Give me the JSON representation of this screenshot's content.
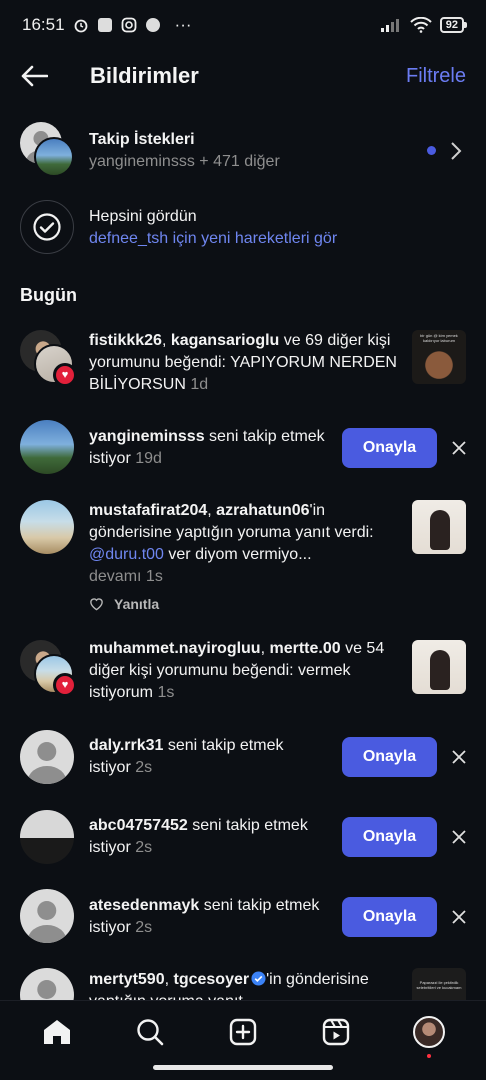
{
  "status_bar": {
    "time": "16:51",
    "more": "···",
    "battery": "92"
  },
  "header": {
    "title": "Bildirimler",
    "filter_label": "Filtrele"
  },
  "follow_requests": {
    "title": "Takip İstekleri",
    "subtitle": "yangineminsss + 471 diğer"
  },
  "seen_all": {
    "title": "Hepsini gördün",
    "link": "defnee_tsh için yeni hareketleri gör"
  },
  "section_today": "Bugün",
  "notifications": [
    {
      "user": "fistikkk26",
      "sep": ", ",
      "user2": "kagansarioglu",
      "text": " ve 69 diğer kişi yorumunu beğendi: YAPIYORUM NERDEN BİLİYORSUN ",
      "time": "1d"
    },
    {
      "user": "yangineminsss",
      "text": " seni takip etmek istiyor ",
      "time": "19d",
      "action": "Onayla"
    },
    {
      "user": "mustafafirat204",
      "sep": ", ",
      "user2": "azrahatun06",
      "text_a": "'in gönderisine yaptığın yoruma yanıt verdi: ",
      "mention": "@duru.t00",
      "text_b": " ver diyom vermiyo...",
      "more": "devamı ",
      "time": "1s",
      "reply": "Yanıtla"
    },
    {
      "user": "muhammet.nayirogluu",
      "sep": ", ",
      "user2": "mertte.00",
      "text": " ve 54 diğer kişi yorumunu beğendi: vermek istiyorum ",
      "time": "1s"
    },
    {
      "user": "daly.rrk31",
      "text": " seni takip etmek istiyor ",
      "time": "2s",
      "action": "Onayla"
    },
    {
      "user": "abc04757452",
      "text": " seni takip etmek istiyor ",
      "time": "2s",
      "action": "Onayla"
    },
    {
      "user": "atesedenmayk",
      "text": " seni takip etmek istiyor ",
      "time": "2s",
      "action": "Onayla"
    },
    {
      "user": "mertyt590",
      "sep": ", ",
      "user2": "tgcesoyer",
      "text": "'in gönderisine yaptığın yoruma yanıt"
    }
  ],
  "thumb_texts": {
    "t1": "bir gün @ kim yemek kaldırıyor laburum",
    "t3": "Paparazzi ile çektirdik selebritileri ve kucakmam"
  },
  "colors": {
    "accent": "#4a5be0",
    "link": "#6f86f0",
    "like": "#e2203a"
  },
  "nav": [
    "home-icon",
    "search-icon",
    "create-icon",
    "reels-icon",
    "profile-avatar"
  ]
}
